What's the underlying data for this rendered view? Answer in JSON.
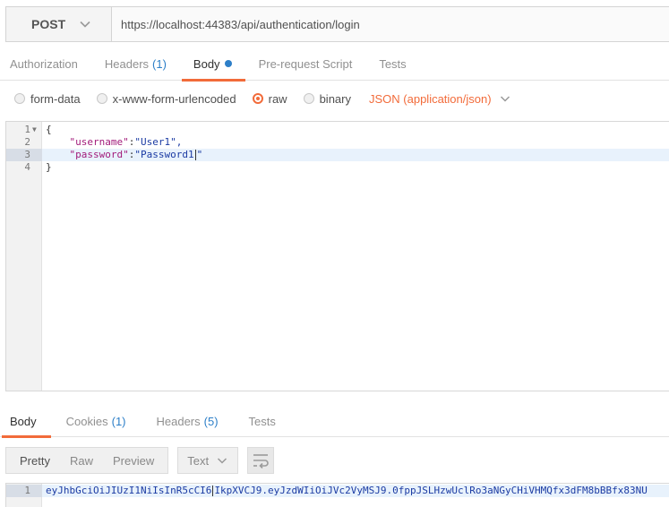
{
  "request": {
    "method": "POST",
    "url": "https://localhost:44383/api/authentication/login"
  },
  "request_tabs": [
    {
      "label": "Authorization"
    },
    {
      "label": "Headers",
      "count": "(1)"
    },
    {
      "label": "Body",
      "active": true
    },
    {
      "label": "Pre-request Script"
    },
    {
      "label": "Tests"
    }
  ],
  "body_types": {
    "form_data": "form-data",
    "urlencoded": "x-www-form-urlencoded",
    "raw": "raw",
    "binary": "binary",
    "selected": "raw",
    "content_type": "JSON (application/json)"
  },
  "editor": {
    "lines": [
      {
        "num": "1",
        "text": "{"
      },
      {
        "num": "2",
        "key": "\"username\"",
        "value": "\"User1\","
      },
      {
        "num": "3",
        "key": "\"password\"",
        "value_before_cursor": "\"Password1",
        "value_after_cursor": "\""
      },
      {
        "num": "4",
        "text": "}"
      }
    ]
  },
  "response_tabs": [
    {
      "label": "Body",
      "active": true
    },
    {
      "label": "Cookies",
      "count": "(1)"
    },
    {
      "label": "Headers",
      "count": "(5)"
    },
    {
      "label": "Tests"
    }
  ],
  "response_toolbar": {
    "pretty": "Pretty",
    "raw": "Raw",
    "preview": "Preview",
    "format": "Text"
  },
  "response_body": {
    "line_num": "1",
    "before_cursor": "eyJhbGciOiJIUzI1NiIsInR5cCI6",
    "after_cursor": "IkpXVCJ9.eyJzdWIiOiJVc2VyMSJ9.0fppJSLHzwUclRo3aNGyCHiVHMQfx3dFM8bBBfx83NU"
  },
  "colors": {
    "accent": "#f26b3a",
    "link_blue": "#2d7fc8",
    "json_key": "#a21b7a",
    "json_string": "#1b3ba3"
  },
  "icons": {
    "method_dropdown": "chevron-down-icon",
    "content_type_dropdown": "chevron-down-icon",
    "format_dropdown": "chevron-down-icon",
    "wrap": "wrap-lines-icon"
  }
}
